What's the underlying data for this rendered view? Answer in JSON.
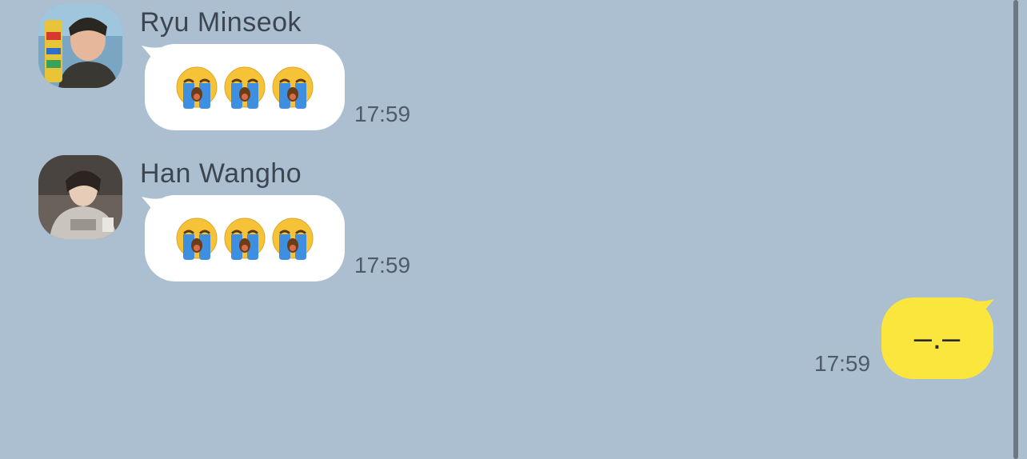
{
  "messages": [
    {
      "sender": "Ryu Minseok",
      "avatar": "avatar-ryu-minseok",
      "content": [
        "loudly-crying-face",
        "loudly-crying-face",
        "loudly-crying-face"
      ],
      "time": "17:59"
    },
    {
      "sender": "Han Wangho",
      "avatar": "avatar-han-wangho",
      "content": [
        "loudly-crying-face",
        "loudly-crying-face",
        "loudly-crying-face"
      ],
      "time": "17:59"
    },
    {
      "sender": "",
      "outgoing": true,
      "text": "–.–",
      "time": "17:59"
    }
  ],
  "colors": {
    "background": "#abbfd1",
    "incoming_bubble": "#ffffff",
    "outgoing_bubble": "#fbe63e",
    "name_text": "#3d4650",
    "time_text": "#4f5b68"
  }
}
